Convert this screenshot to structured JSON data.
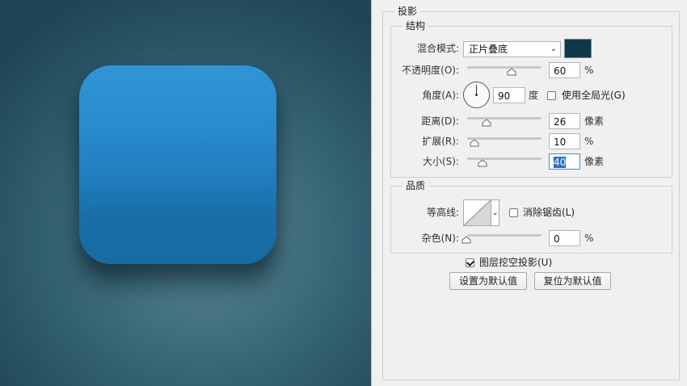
{
  "panel": {
    "drop_shadow_title": "投影",
    "structure": {
      "title": "结构",
      "blend_mode_label": "混合模式:",
      "blend_mode_value": "正片叠底",
      "shadow_color": "#0d3a4a",
      "opacity_label": "不透明度(O):",
      "opacity_value": "60",
      "opacity_unit": "%",
      "angle_label": "角度(A):",
      "angle_value": "90",
      "angle_unit": "度",
      "use_global_light_label": "使用全局光(G)",
      "use_global_light_checked": false,
      "distance_label": "距离(D):",
      "distance_value": "26",
      "distance_unit": "像素",
      "spread_label": "扩展(R):",
      "spread_value": "10",
      "spread_unit": "%",
      "size_label": "大小(S):",
      "size_value": "40",
      "size_unit": "像素"
    },
    "quality": {
      "title": "品质",
      "contour_label": "等高线:",
      "anti_alias_label": "消除锯齿(L)",
      "anti_alias_checked": false,
      "noise_label": "杂色(N):",
      "noise_value": "0",
      "noise_unit": "%"
    },
    "layer_knocks_out_label": "图层挖空投影(U)",
    "layer_knocks_out_checked": true,
    "make_default_label": "设置为默认值",
    "reset_default_label": "复位为默认值"
  },
  "colors": {
    "icon_top": "#3095d6",
    "icon_bottom": "#176aa2",
    "canvas_center": "#5c8896",
    "canvas_edge": "#1f4456"
  }
}
